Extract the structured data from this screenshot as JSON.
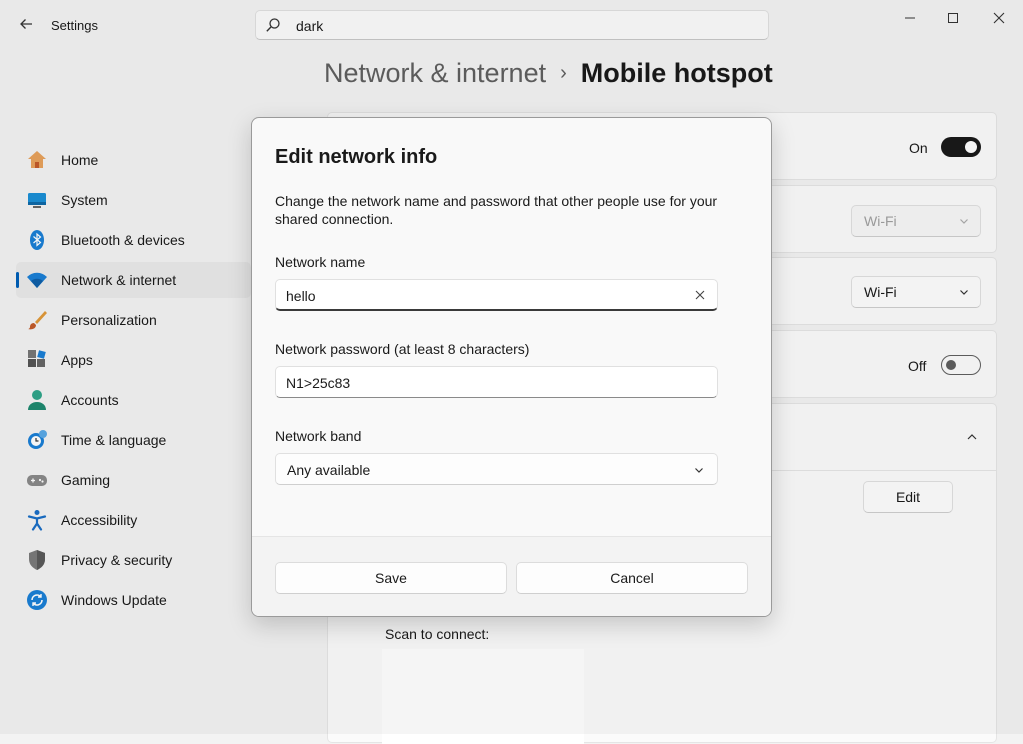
{
  "app": {
    "title": "Settings",
    "search_value": "dark"
  },
  "breadcrumb": {
    "parent": "Network & internet",
    "separator": "›",
    "current": "Mobile hotspot"
  },
  "sidebar": {
    "items": [
      {
        "label": "Home",
        "icon": "home-icon"
      },
      {
        "label": "System",
        "icon": "system-icon"
      },
      {
        "label": "Bluetooth & devices",
        "icon": "bluetooth-icon"
      },
      {
        "label": "Network & internet",
        "icon": "wifi-icon",
        "selected": true
      },
      {
        "label": "Personalization",
        "icon": "brush-icon"
      },
      {
        "label": "Apps",
        "icon": "apps-icon"
      },
      {
        "label": "Accounts",
        "icon": "account-icon"
      },
      {
        "label": "Time & language",
        "icon": "clock-globe-icon"
      },
      {
        "label": "Gaming",
        "icon": "gamepad-icon"
      },
      {
        "label": "Accessibility",
        "icon": "accessibility-icon"
      },
      {
        "label": "Privacy & security",
        "icon": "shield-icon"
      },
      {
        "label": "Windows Update",
        "icon": "update-icon"
      }
    ]
  },
  "background": {
    "hotspot_state": "On",
    "share_from_value": "Wi-Fi",
    "share_over_value": "Wi-Fi",
    "power_saving_state": "Off",
    "edit_label": "Edit",
    "scan_label": "Scan to connect:"
  },
  "dialog": {
    "title": "Edit network info",
    "description": "Change the network name and password that other people use for your shared connection.",
    "name_label": "Network name",
    "name_value": "hello",
    "password_label": "Network password (at least 8 characters)",
    "password_value": "N1>25c83",
    "band_label": "Network band",
    "band_value": "Any available",
    "save_label": "Save",
    "cancel_label": "Cancel"
  },
  "colors": {
    "accent": "#005fb8",
    "toggle_on": "#1a1a1a"
  }
}
